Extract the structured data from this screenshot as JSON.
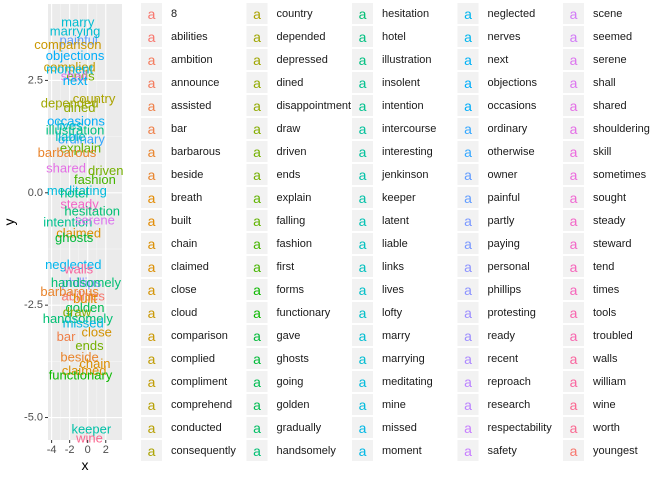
{
  "chart_data": {
    "type": "scatter",
    "mark": "text",
    "xlabel": "x",
    "ylabel": "y",
    "xlim": [
      -4.4,
      3.8
    ],
    "ylim": [
      -5.5,
      4.2
    ],
    "x_ticks": [
      -4,
      -2,
      0,
      2
    ],
    "x_tick_labels": [
      "-4",
      "-2",
      "0",
      "2"
    ],
    "y_ticks": [
      -5.0,
      -2.5,
      0.0,
      2.5
    ],
    "y_tick_labels": [
      "-5.0",
      "-2.5",
      "0.0",
      "2.5"
    ],
    "grid": true,
    "legend_position": "right",
    "legend_key_glyph": "a",
    "legend_columns": 5,
    "legend_rows": 20,
    "labels": [
      "8",
      "abilities",
      "ambition",
      "announce",
      "assisted",
      "bar",
      "barbarous",
      "beside",
      "breath",
      "built",
      "chain",
      "claimed",
      "close",
      "cloud",
      "comparison",
      "complied",
      "compliment",
      "comprehend",
      "conducted",
      "consequently",
      "country",
      "depended",
      "depressed",
      "dined",
      "disappointment",
      "draw",
      "driven",
      "ends",
      "explain",
      "falling",
      "fashion",
      "first",
      "forms",
      "functionary",
      "gave",
      "ghosts",
      "going",
      "golden",
      "gradually",
      "handsomely",
      "hesitation",
      "hotel",
      "illustration",
      "insolent",
      "intention",
      "intercourse",
      "interesting",
      "jenkinson",
      "keeper",
      "latent",
      "liable",
      "links",
      "lives",
      "lofty",
      "marry",
      "marrying",
      "meditating",
      "mine",
      "missed",
      "moment",
      "neglected",
      "nerves",
      "next",
      "objections",
      "occasions",
      "ordinary",
      "otherwise",
      "owner",
      "painful",
      "partly",
      "paying",
      "personal",
      "phillips",
      "protesting",
      "ready",
      "recent",
      "reproach",
      "research",
      "respectability",
      "safety",
      "scene",
      "seemed",
      "serene",
      "shall",
      "shared",
      "shouldering",
      "skill",
      "sometimes",
      "sought",
      "steady",
      "steward",
      "tend",
      "times",
      "tools",
      "troubled",
      "walls",
      "william",
      "wine",
      "worth",
      "youngest"
    ],
    "colors": [
      "#F8766D",
      "#F47A5C",
      "#EF7F48",
      "#E9842C",
      "#E28A00",
      "#DB8E00",
      "#D39200",
      "#CA9700",
      "#C09B00",
      "#B69F00",
      "#ABA300",
      "#9FA600",
      "#92AA00",
      "#84AD00",
      "#74B000",
      "#60B300",
      "#46B500",
      "#0DB800",
      "#00BA38",
      "#00BC51",
      "#00BE63",
      "#00BF73",
      "#00C081",
      "#00C18E",
      "#00C19B",
      "#00C1A7",
      "#00C1B3",
      "#00C0BE",
      "#00BFC8",
      "#00BDD2",
      "#00BBDC",
      "#00B8E5",
      "#00B5EE",
      "#00B1F6",
      "#00ADFA",
      "#35A7FF",
      "#619CFF",
      "#7A98FF",
      "#8C93FF",
      "#9D8EFF",
      "#AD89FF",
      "#BB83FF",
      "#C77DFF",
      "#D279F7",
      "#DC74EF",
      "#E46EE6",
      "#EB6ADD",
      "#F067D2",
      "#F366C7",
      "#F664BB",
      "#F865AE",
      "#F9659F",
      "#FA6790",
      "#F8766D"
    ],
    "points": [
      {
        "label": "marry",
        "x": -1.1,
        "y": 3.8
      },
      {
        "label": "painful",
        "x": -1.0,
        "y": 3.4
      },
      {
        "label": "marrying",
        "x": -1.4,
        "y": 3.6
      },
      {
        "label": "comparison",
        "x": -2.2,
        "y": 3.3
      },
      {
        "label": "objections",
        "x": -1.4,
        "y": 3.05
      },
      {
        "label": "ends",
        "x": -0.8,
        "y": 2.6
      },
      {
        "label": "complied",
        "x": -2.0,
        "y": 2.8
      },
      {
        "label": "shall",
        "x": -1.5,
        "y": 2.6
      },
      {
        "label": "next",
        "x": -1.4,
        "y": 2.5
      },
      {
        "label": "moment",
        "x": -2.0,
        "y": 2.75
      },
      {
        "label": "country",
        "x": 0.7,
        "y": 2.1
      },
      {
        "label": "depended",
        "x": -2.0,
        "y": 2.0
      },
      {
        "label": "dined",
        "x": -0.9,
        "y": 1.9
      },
      {
        "label": "occasions",
        "x": -1.3,
        "y": 1.6
      },
      {
        "label": "lives",
        "x": -2.0,
        "y": 1.5
      },
      {
        "label": "ordinary",
        "x": -0.7,
        "y": 1.2
      },
      {
        "label": "explain",
        "x": -0.8,
        "y": 1.0
      },
      {
        "label": "barbarous",
        "x": -2.3,
        "y": 0.9
      },
      {
        "label": "illustration",
        "x": -1.4,
        "y": 1.4
      },
      {
        "label": "liable",
        "x": -1.9,
        "y": 1.25
      },
      {
        "label": "shared",
        "x": -2.4,
        "y": 0.55
      },
      {
        "label": "fashion",
        "x": 0.8,
        "y": 0.3
      },
      {
        "label": "driven",
        "x": 2.0,
        "y": 0.5
      },
      {
        "label": "meditating",
        "x": -1.2,
        "y": 0.05
      },
      {
        "label": "hotel",
        "x": -1.5,
        "y": 0.0
      },
      {
        "label": "steady",
        "x": -0.9,
        "y": -0.25
      },
      {
        "label": "hesitation",
        "x": 0.5,
        "y": -0.4
      },
      {
        "label": "intention",
        "x": -2.2,
        "y": -0.65
      },
      {
        "label": "claimed",
        "x": -1.0,
        "y": -0.9
      },
      {
        "label": "ghosts",
        "x": -1.5,
        "y": -1.0
      },
      {
        "label": "serene",
        "x": 0.8,
        "y": -0.6
      },
      {
        "label": "neglected",
        "x": -1.6,
        "y": -1.6
      },
      {
        "label": "phillips",
        "x": -0.7,
        "y": -2.0
      },
      {
        "label": "walls",
        "x": -1.0,
        "y": -1.7
      },
      {
        "label": "handsomely",
        "x": -0.2,
        "y": -2.0
      },
      {
        "label": "abilities",
        "x": -0.5,
        "y": -2.3
      },
      {
        "label": "barbarous",
        "x": -2.0,
        "y": -2.2
      },
      {
        "label": "built",
        "x": -0.3,
        "y": -2.35
      },
      {
        "label": "golden",
        "x": -0.3,
        "y": -2.55
      },
      {
        "label": "draw",
        "x": -1.2,
        "y": -2.65
      },
      {
        "label": "handsomely",
        "x": -1.1,
        "y": -2.8
      },
      {
        "label": "missed",
        "x": -0.5,
        "y": -2.9
      },
      {
        "label": "bar",
        "x": -2.4,
        "y": -3.2
      },
      {
        "label": "close",
        "x": 1.0,
        "y": -3.1
      },
      {
        "label": "ends",
        "x": 0.2,
        "y": -3.4
      },
      {
        "label": "beside",
        "x": -0.9,
        "y": -3.65
      },
      {
        "label": "chain",
        "x": 0.8,
        "y": -3.8
      },
      {
        "label": "claimed",
        "x": -0.4,
        "y": -3.95
      },
      {
        "label": "functionary",
        "x": -0.8,
        "y": -4.05
      },
      {
        "label": "keeper",
        "x": 0.4,
        "y": -5.25
      },
      {
        "label": "wine",
        "x": 0.2,
        "y": -5.45
      }
    ]
  }
}
